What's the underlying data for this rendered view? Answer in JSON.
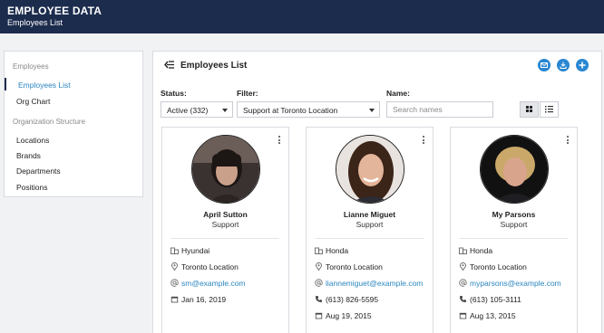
{
  "header": {
    "title": "EMPLOYEE DATA",
    "subtitle": "Employees List"
  },
  "sidebar": {
    "section1": "Employees",
    "items1": [
      {
        "label": "Employees List"
      },
      {
        "label": "Org Chart"
      }
    ],
    "section2": "Organization Structure",
    "items2": [
      {
        "label": "Locations"
      },
      {
        "label": "Brands"
      },
      {
        "label": "Departments"
      },
      {
        "label": "Positions"
      }
    ]
  },
  "main": {
    "title": "Employees List",
    "filters": {
      "status_label": "Status:",
      "status_value": "Active (332)",
      "filter_label": "Filter:",
      "filter_value": "Support at Toronto Location",
      "name_label": "Name:",
      "name_placeholder": "Search names",
      "name_value": ""
    }
  },
  "employees": [
    {
      "name": "April Sutton",
      "role": "Support",
      "brand": "Hyundai",
      "location": "Toronto Location",
      "email": "sm@example.com",
      "date": "Jan 16, 2019"
    },
    {
      "name": "Lianne Miguet",
      "role": "Support",
      "brand": "Honda",
      "location": "Toronto Location",
      "email": "liannemiguet@example.com",
      "phone": "(613) 826-5595",
      "date": "Aug 19, 2015"
    },
    {
      "name": "My Parsons",
      "role": "Support",
      "brand": "Honda",
      "location": "Toronto Location",
      "email": "myparsons@example.com",
      "phone": "(613) 105-3111",
      "date": "Aug 13, 2015"
    }
  ],
  "colors": {
    "header_bg": "#1c2c4d",
    "accent": "#2a86d1",
    "link": "#2a86bf"
  }
}
